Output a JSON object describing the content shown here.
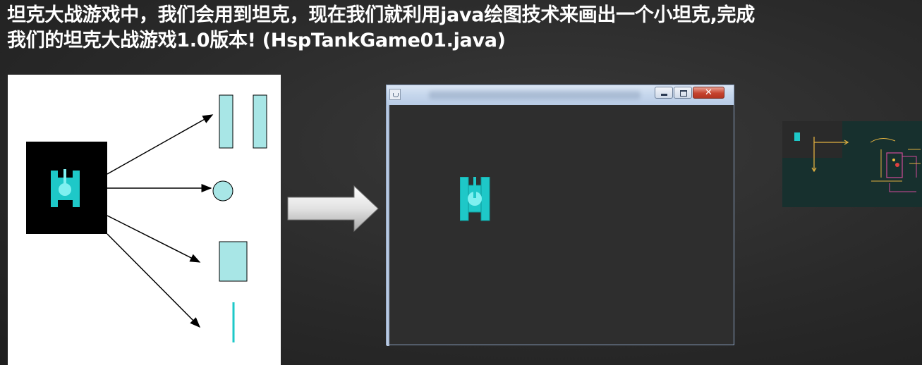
{
  "heading": {
    "line1": "坦克大战游戏中，我们会用到坦克，现在我们就利用java绘图技术来画出一个小坦克,完成",
    "line2": "我们的坦克大战游戏1.0版本! (HspTankGame01.java)"
  },
  "colors": {
    "tank_fill": "#1ec8c8",
    "shape_fill": "#a8e6e6",
    "canvas_bg": "#2e2e2e",
    "panel_bg": "#ffffff"
  },
  "diagram": {
    "component_shapes": [
      "rectangle",
      "rectangle",
      "circle",
      "rectangle",
      "line"
    ]
  },
  "window": {
    "icon": "java-cup-icon"
  }
}
